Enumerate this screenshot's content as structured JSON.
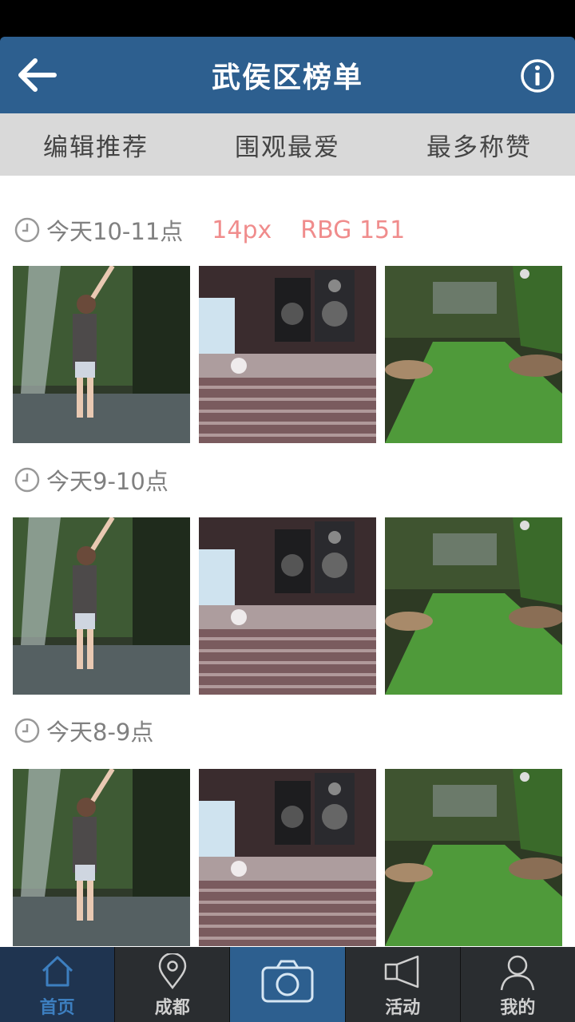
{
  "header": {
    "title": "武侯区榜单",
    "back_icon": "back-arrow-icon",
    "info_icon": "info-icon"
  },
  "tabs": [
    {
      "label": "编辑推荐"
    },
    {
      "label": "围观最爱"
    },
    {
      "label": "最多称赞"
    }
  ],
  "sections": [
    {
      "title": "今天10-11点",
      "notes": [
        "14px",
        "RBG 151"
      ]
    },
    {
      "title": "今天9-10点"
    },
    {
      "title": "今天8-9点"
    }
  ],
  "bottom_nav": [
    {
      "label": "首页",
      "icon": "home-icon",
      "active": true
    },
    {
      "label": "成都",
      "icon": "location-pin-icon"
    },
    {
      "label": "",
      "icon": "camera-icon"
    },
    {
      "label": "活动",
      "icon": "megaphone-icon"
    },
    {
      "label": "我的",
      "icon": "user-icon"
    }
  ],
  "colors": {
    "header_bg": "#2d5f8f",
    "tab_bg": "#d9d9d9",
    "note_text": "#f08c8c",
    "active_nav_text": "#3d7fc0"
  }
}
